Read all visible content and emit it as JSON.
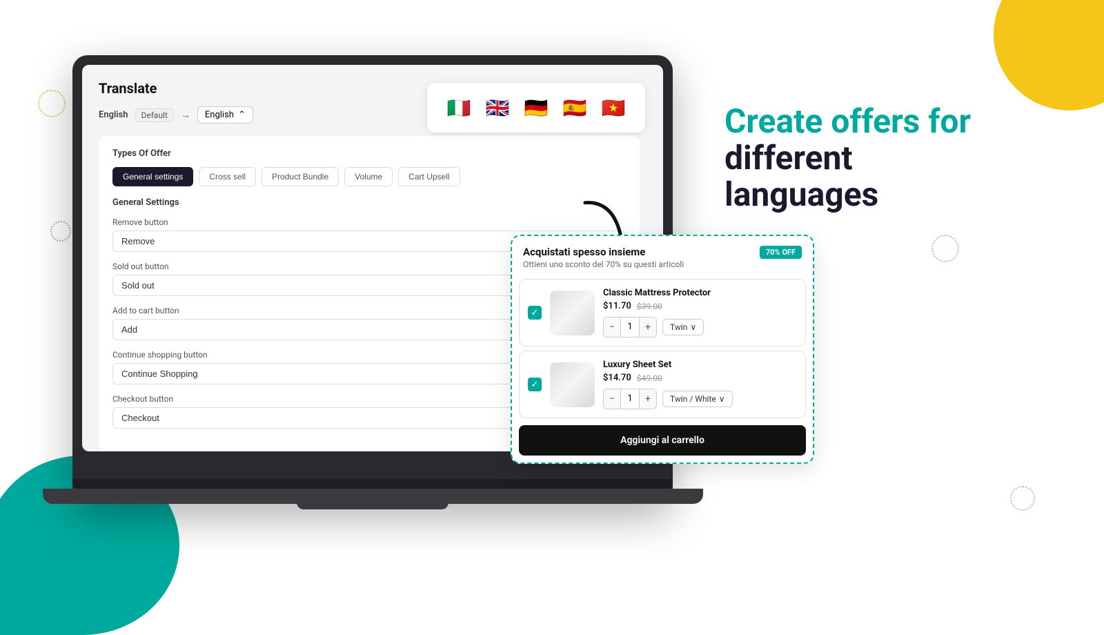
{
  "page": {
    "background": "#ffffff"
  },
  "heading": {
    "line1": "Create offers for",
    "line2": "different",
    "line3": "languages"
  },
  "translate_panel": {
    "title": "Translate",
    "source_lang": "English",
    "source_badge": "Default",
    "arrow": "→",
    "target_lang": "English",
    "target_chevron": "⌃"
  },
  "flags": [
    "🇮🇹",
    "🇬🇧",
    "🇩🇪",
    "🇪🇸",
    "🇻🇳"
  ],
  "types_of_offer": {
    "title": "Types Of Offer",
    "tabs": [
      {
        "label": "General settings",
        "active": true
      },
      {
        "label": "Cross sell",
        "active": false
      },
      {
        "label": "Product Bundle",
        "active": false
      },
      {
        "label": "Volume",
        "active": false
      },
      {
        "label": "Cart Upsell",
        "active": false
      }
    ]
  },
  "general_settings": {
    "title": "General Settings",
    "fields": [
      {
        "label": "Remove button",
        "value": "Remove"
      },
      {
        "label": "Sold out button",
        "value": "Sold out"
      },
      {
        "label": "Add to cart button",
        "value": "Add"
      },
      {
        "label": "Continue shopping button",
        "value": "Continue Shopping"
      },
      {
        "label": "Checkout button",
        "value": "Checkout"
      }
    ]
  },
  "widget": {
    "title": "Acquistati spesso insieme",
    "subtitle": "Ottieni uno sconto del 70% su questi articoli",
    "badge": "70% OFF",
    "products": [
      {
        "name": "Classic Mattress Protector",
        "price_new": "$11.70",
        "price_old": "$39.00",
        "qty": "1",
        "variant": "Twin",
        "checked": true
      },
      {
        "name": "Luxury Sheet Set",
        "price_new": "$14.70",
        "price_old": "$49.00",
        "qty": "1",
        "variant": "Twin / White",
        "checked": true
      }
    ],
    "add_to_cart_label": "Aggiungi al carrello"
  }
}
